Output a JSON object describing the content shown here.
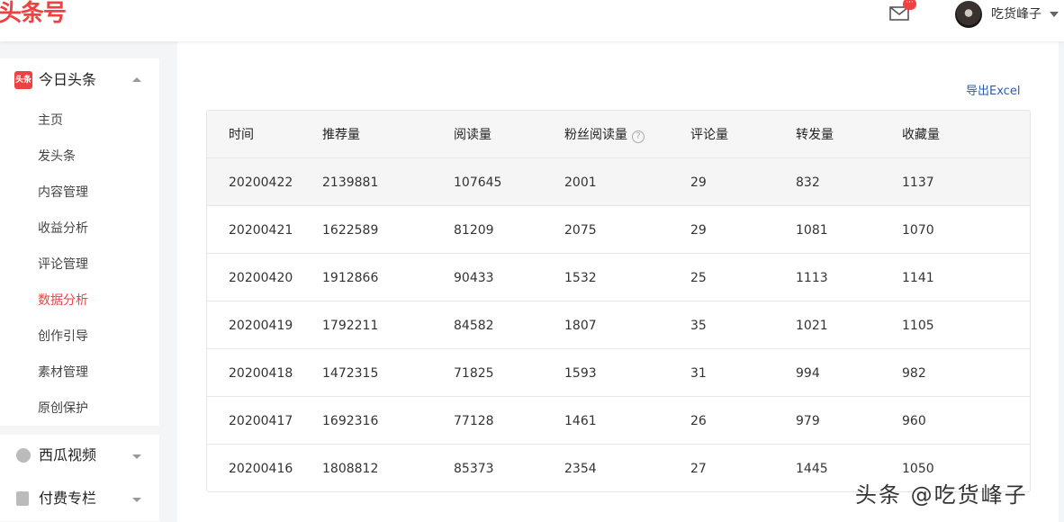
{
  "header": {
    "logo_text": "头条号",
    "mail_badge": "···",
    "username": "吃货峰子"
  },
  "sidebar": {
    "main_block": {
      "icon_text": "头条",
      "title": "今日头条",
      "items": [
        {
          "label": "主页"
        },
        {
          "label": "发头条"
        },
        {
          "label": "内容管理"
        },
        {
          "label": "收益分析"
        },
        {
          "label": "评论管理"
        },
        {
          "label": "数据分析",
          "active": true
        },
        {
          "label": "创作引导"
        },
        {
          "label": "素材管理"
        },
        {
          "label": "原创保护"
        }
      ]
    },
    "sub_blocks": [
      {
        "title": "西瓜视频"
      },
      {
        "title": "付费专栏"
      }
    ]
  },
  "main": {
    "export_label": "导出Excel",
    "table": {
      "columns": [
        "时间",
        "推荐量",
        "阅读量",
        "粉丝阅读量",
        "评论量",
        "转发量",
        "收藏量"
      ],
      "rows": [
        [
          "20200422",
          "2139881",
          "107645",
          "2001",
          "29",
          "832",
          "1137"
        ],
        [
          "20200421",
          "1622589",
          "81209",
          "2075",
          "29",
          "1081",
          "1070"
        ],
        [
          "20200420",
          "1912866",
          "90433",
          "1532",
          "25",
          "1113",
          "1141"
        ],
        [
          "20200419",
          "1792211",
          "84582",
          "1807",
          "35",
          "1021",
          "1105"
        ],
        [
          "20200418",
          "1472315",
          "71825",
          "1593",
          "31",
          "994",
          "982"
        ],
        [
          "20200417",
          "1692316",
          "77128",
          "1461",
          "26",
          "979",
          "960"
        ],
        [
          "20200416",
          "1808812",
          "85373",
          "2354",
          "27",
          "1445",
          "1050"
        ]
      ]
    }
  },
  "watermark": "头条 @吃货峰子",
  "colors": {
    "brand": "#f04142",
    "link": "#2a5db0"
  },
  "icons": {
    "mail": "mail-icon",
    "help": "question-circle-icon"
  }
}
